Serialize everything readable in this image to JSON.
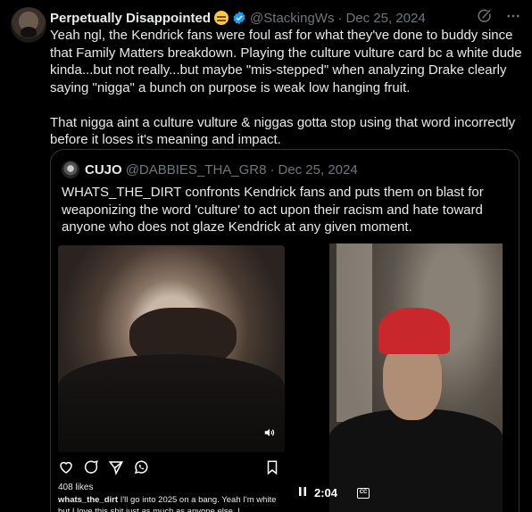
{
  "tweet": {
    "display_name": "Perpetually Disappointed",
    "handle": "@StackingWs",
    "separator": "·",
    "date": "Dec 25, 2024",
    "text": "Yeah ngl, the Kendrick fans were foul asf for what they've done to buddy since that Family Matters breakdown. Playing the culture vulture card bc a white dude kinda...but not really...but maybe \"mis-stepped\" when analyzing Drake clearly saying \"nigga\" a bunch on purpose is weak low hanging fruit.\n\nThat nigga aint a culture vulture & niggas gotta stop using that word incorrectly before it loses it's meaning and impact."
  },
  "quote": {
    "display_name": "CUJO",
    "handle": "@DABBIES_THA_GR8",
    "separator": "·",
    "date": "Dec 25, 2024",
    "text": "WHATS_THE_DIRT confronts Kendrick fans and puts them on blast for weaponizing the word 'culture' to act upon their racism and hate toward anyone who does not glaze Kendrick at any given moment."
  },
  "media": {
    "likes": "408 likes",
    "caption_user": "whats_the_dirt",
    "caption_text": "I'll go into 2025 on a bang. Yeah I'm white but I love this shit just as much as anyone else. I",
    "player_time": "2:04",
    "cc_label": "CC"
  },
  "colors": {
    "background": "#000000",
    "text": "#e7e9ea",
    "muted": "#71767b",
    "verified": "#1d9bf0",
    "border": "#2f3336"
  },
  "icons": [
    "grok-icon",
    "more-icon",
    "verified-icon",
    "volume-icon",
    "heart-icon",
    "comment-icon",
    "share-icon",
    "whatsapp-icon",
    "bookmark-icon",
    "pause-icon",
    "captions-icon"
  ]
}
